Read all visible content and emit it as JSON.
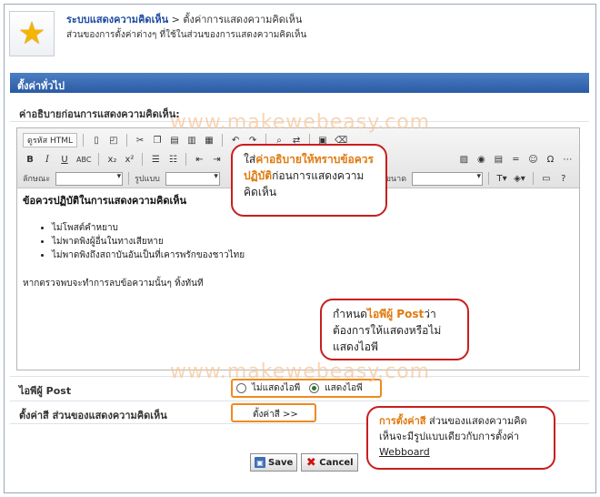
{
  "header": {
    "breadcrumb_link": "ระบบแสดงความคิดเห็น",
    "breadcrumb_sep": ">",
    "breadcrumb_current": "ตั้งค่าการแสดงความคิดเห็น",
    "description": "ส่วนของการตั้งค่าต่างๆ ที่ใช้ในส่วนของการแสดงความคิดเห็น"
  },
  "panel": {
    "title": "ตั้งค่าทั่วไป"
  },
  "watermark": "www.makewebeasy.com",
  "editor_section": {
    "label": "ค่าอธิบายก่อนการแสดงความคิดเห็น:"
  },
  "toolbar": {
    "source_label": "ดูรหัส HTML",
    "font_label": "ลักษณะ",
    "format_label": "รูปแบบ",
    "size_label": "ขนาด",
    "bold": "B",
    "italic": "I",
    "underline": "U",
    "strike": "ABC",
    "subscript": "x₂",
    "superscript": "x²"
  },
  "editor_content": {
    "title": "ข้อควรปฏิบัติในการแสดงความคิดเห็น",
    "items": [
      "ไม่โพสต์คำหยาบ",
      "ไม่พาดพิงผู้อื่นในทางเสียหาย",
      "ไม่พาดพิงถึงสถาบันอันเป็นที่เคารพรักของชาวไทย"
    ],
    "note": "หากตรวจพบจะทำการลบข้อความนั้นๆ ทิ้งทันที"
  },
  "fields": {
    "poster_ip": {
      "label": "ไอพีผู้ Post",
      "options": [
        "ไม่แสดงไอพี",
        "แสดงไอพี"
      ],
      "selected": 1
    },
    "color": {
      "label": "ตั้งค่าสี ส่วนของแสดงความคิดเห็น",
      "button": "ตั้งค่าสี >>"
    }
  },
  "callouts": {
    "c1": {
      "pre": "ใส่",
      "hl": "ค่าอธิบายให้ทราบข้อควรปฏิบัติ",
      "post": "ก่อนการแสดงความคิดเห็น"
    },
    "c2": {
      "pre": "กำหนด",
      "hl": "ไอพีผู้ Post",
      "post": "ว่าต้องการให้แสดงหรือไม่แสดงไอพี"
    },
    "c3": {
      "hl": "การตั้งค่าสี",
      "mid": " ส่วนของแสดงความคิดเห็นจะมีรูปแบบเดียวกับการตั้งค่า ",
      "u": "Webboard"
    }
  },
  "buttons": {
    "save": "Save",
    "cancel": "Cancel"
  },
  "colors": {
    "panel_header": "#2a5aa4",
    "highlight": "#e07a10",
    "callout_border": "#c81e1e",
    "field_border": "#ef8a1e"
  }
}
